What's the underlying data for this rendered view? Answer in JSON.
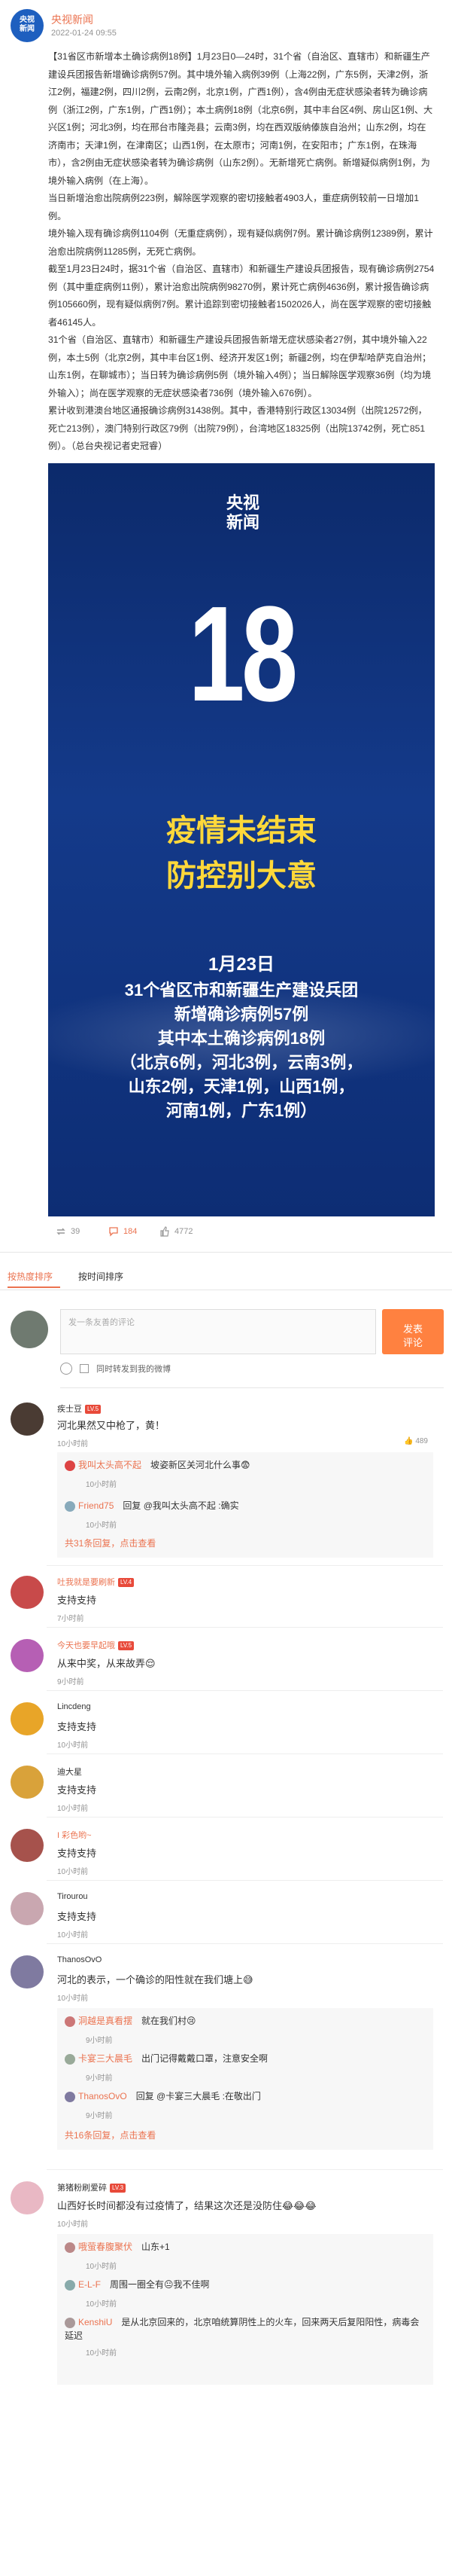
{
  "post": {
    "author": "央视新闻",
    "time": "2022-01-24 09:55",
    "avatar_text": "央视\n新闻",
    "paragraphs": [
      "【31省区市新增本土确诊病例18例】1月23日0—24时，31个省（自治区、直辖市）和新疆生产建设兵团报告新增确诊病例57例。其中境外输入病例39例（上海22例，广东5例，天津2例，浙江2例，福建2例，四川2例，云南2例，北京1例，广西1例），含4例由无症状感染者转为确诊病例（浙江2例，广东1例，广西1例）；本土病例18例（北京6例，其中丰台区4例、房山区1例、大兴区1例；河北3例，均在邢台市隆尧县；云南3例，均在西双版纳傣族自治州；山东2例，均在济南市；天津1例，在津南区；山西1例，在太原市；河南1例，在安阳市；广东1例，在珠海市），含2例由无症状感染者转为确诊病例（山东2例）。无新增死亡病例。新增疑似病例1例，为境外输入病例（在上海）。",
      "当日新增治愈出院病例223例，解除医学观察的密切接触者4903人，重症病例较前一日增加1例。",
      "境外输入现有确诊病例1104例（无重症病例），现有疑似病例7例。累计确诊病例12389例，累计治愈出院病例11285例，无死亡病例。",
      "截至1月23日24时，据31个省（自治区、直辖市）和新疆生产建设兵团报告，现有确诊病例2754例（其中重症病例11例），累计治愈出院病例98270例，累计死亡病例4636例，累计报告确诊病例105660例，现有疑似病例7例。累计追踪到密切接触者1502026人，尚在医学观察的密切接触者46145人。",
      "31个省（自治区、直辖市）和新疆生产建设兵团报告新增无症状感染者27例，其中境外输入22例，本土5例（北京2例，其中丰台区1例、经济开发区1例；新疆2例，均在伊犁哈萨克自治州；山东1例，在聊城市）；当日转为确诊病例5例（境外输入4例）；当日解除医学观察36例（均为境外输入）；尚在医学观察的无症状感染者736例（境外输入676例）。",
      "累计收到港澳台地区通报确诊病例31438例。其中，香港特别行政区13034例（出院12572例，死亡213例），澳门特别行政区79例（出院79例），台湾地区18325例（出院13742例，死亡851例）。（总台央视记者史冠睿）"
    ]
  },
  "poster": {
    "logo_line1": "央视",
    "logo_line2": "新闻",
    "big_number": "18",
    "slogan1": "疫情未结束",
    "slogan2": "防控别大意",
    "date": "1月23日",
    "line1": "31个省区市和新疆生产建设兵团",
    "line2": "新增确诊病例57例",
    "line3": "其中本土确诊病例18例",
    "line4": "（北京6例，河北3例，云南3例，",
    "line5": "山东2例，天津1例，山西1例，",
    "line6": "河南1例，广东1例）"
  },
  "actions": {
    "repost": "39",
    "comment": "184",
    "like": "4772"
  },
  "tabs": {
    "hot": "按热度排序",
    "time": "按时间排序"
  },
  "compose": {
    "placeholder": "发一条友善的评论",
    "button": "发表\n评论",
    "repost_label": "同时转发到我的微博"
  },
  "comments": [
    {
      "name": "疾士豆",
      "text": "河北果然又中枪了，黄！",
      "time": "10小时前",
      "likes": "489",
      "replies": [
        {
          "name": "我叫太头高不起",
          "text": "坡姿新区关河北什么事😨",
          "time": "10小时前"
        },
        {
          "name": "Friend75",
          "text": "回复 @我叫太头高不起 :确实",
          "time": "10小时前"
        }
      ],
      "more": "共31条回复，点击查看"
    },
    {
      "name": "吐我就是要刷新",
      "text": "支持支持",
      "time": "7小时前",
      "likes": ""
    },
    {
      "name": "今天也要早起哦",
      "text": "从来中奖，从来故弄😌",
      "time": "9小时前",
      "likes": ""
    },
    {
      "name": "Lincdeng",
      "text": "支持支持",
      "time": "10小时前",
      "likes": ""
    },
    {
      "name": "迪大星",
      "text": "支持支持",
      "time": "10小时前",
      "likes": ""
    },
    {
      "name": "I 彩色哟~",
      "text": "支持支持",
      "time": "10小时前",
      "likes": ""
    },
    {
      "name": "Tirourou",
      "text": "支持支持",
      "time": "10小时前",
      "likes": ""
    },
    {
      "name": "ThanosOvO",
      "text": "河北的表示，一个确诊的阳性就在我们塘上😅",
      "time": "10小时前",
      "likes": "",
      "replies": [
        {
          "name": "洞越是真看摆",
          "text": "就在我们村😢",
          "time": "9小时前"
        },
        {
          "name": "卡宴三大晨毛",
          "text": "出门记得戴戴口罩，注意安全啊",
          "time": "9小时前"
        },
        {
          "name": "ThanosOvO",
          "text": "回复 @卡宴三大晨毛 :在敬出门",
          "time": "9小时前"
        }
      ],
      "more": "共16条回复，点击查看"
    },
    {
      "name": "第猪粉刷爱碎",
      "text": "山西好长时间都没有过疫情了，结果这次还是没防住😂😂😂",
      "time": "10小时前",
      "likes": "",
      "replies": [
        {
          "name": "哦萤春腹聚伏",
          "text": "山东+1",
          "time": "10小时前"
        },
        {
          "name": "E-L-F",
          "text": "周围一圈全有😐我不佳啊",
          "time": "10小时前"
        },
        {
          "name": "KenshiU",
          "text": "是从北京回来的，北京咱统算阴性上的火车，回来两天后复阳阳性，病毒会延迟",
          "time": "10小时前"
        }
      ]
    }
  ],
  "colors": {
    "accent": "#eb7350",
    "button": "#ff8140",
    "poster_bg": "#143a8a",
    "slogan": "#ffd83a"
  }
}
